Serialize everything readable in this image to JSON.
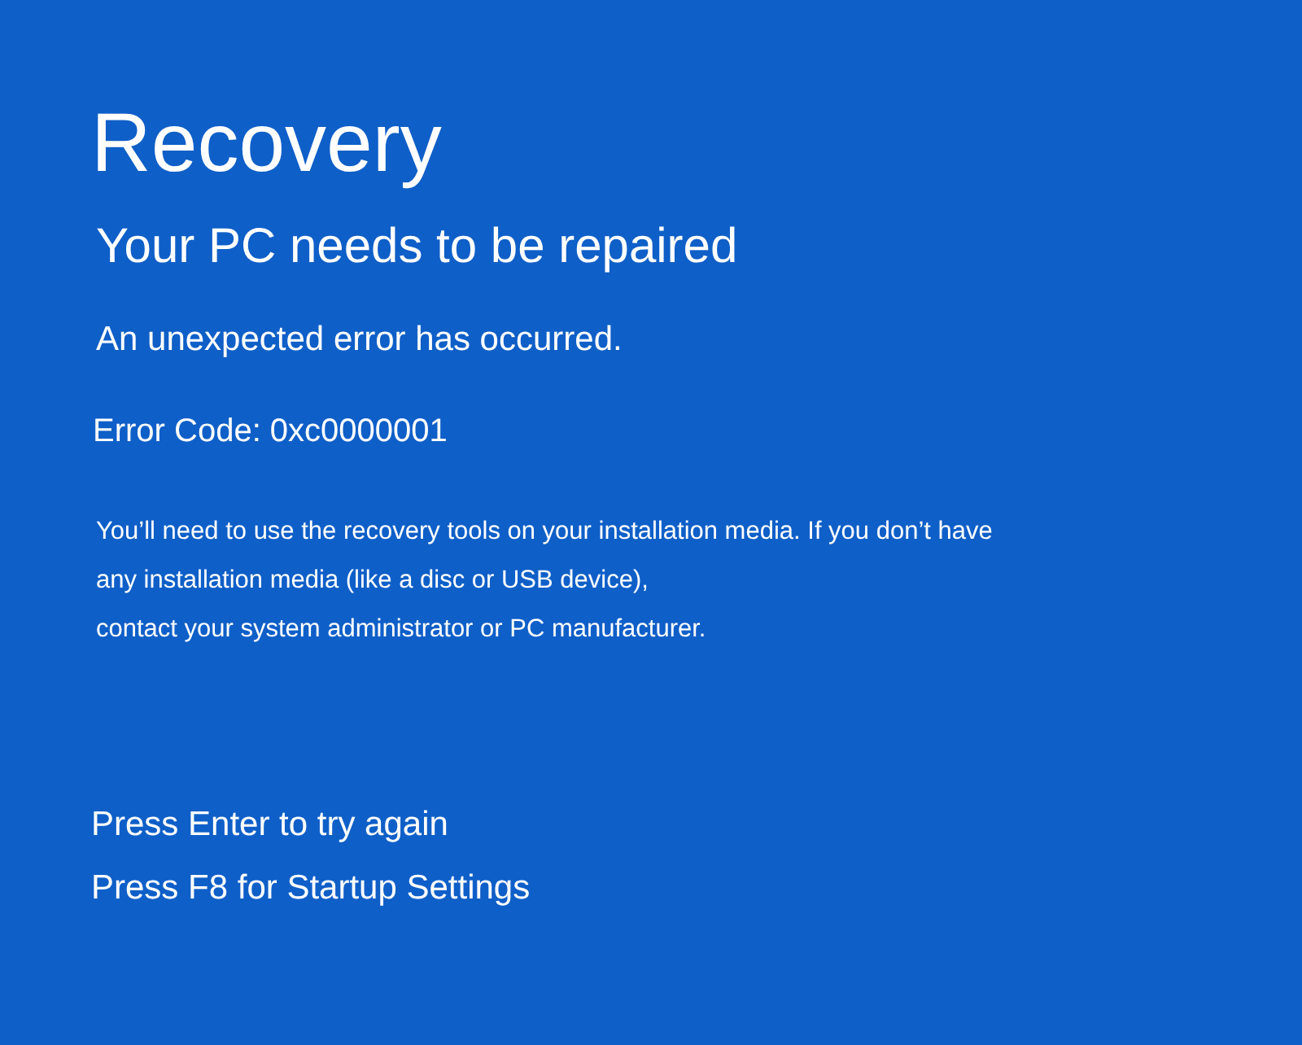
{
  "title": "Recovery",
  "heading": "Your PC needs to be repaired",
  "message": "An unexpected error has occurred.",
  "error_code": "Error Code: 0xc0000001",
  "details": [
    "You’ll need to use the recovery tools on your installation media. If you don’t have",
    "any installation media (like a disc or USB device),",
    "contact your system administrator or PC manufacturer."
  ],
  "options": [
    "Press Enter to try again",
    "Press F8 for Startup Settings"
  ]
}
